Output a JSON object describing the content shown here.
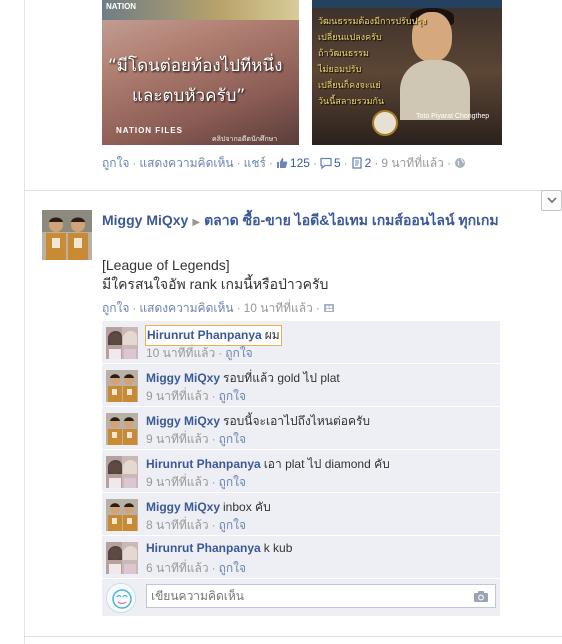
{
  "story": {
    "photo_a": {
      "top_label": "NATION",
      "quote_line1": "“มีโดนต่อยท้องไปทีหนึ่ง",
      "quote_line2": "และตบหัวครับ”",
      "logo": "NATION FILES",
      "logo_sub": "คลิปจากอดีตนักศึกษา"
    },
    "photo_b": {
      "lines": [
        "วัฒนธรรมต้องมีการปรับปรุง",
        "เปลี่ยนแปลงครับ",
        "ถ้าวัฒนธรรม",
        "ไม่ยอมปรับ",
        "เปลี่ยนก็คงจะแย่",
        "วันนี้สลายรวมกัน"
      ],
      "caption": "Toto Piyarat Chongthep"
    },
    "actions": {
      "like": "ถูกใจ",
      "comment": "แสดงความคิดเห็น",
      "share": "แชร์",
      "likes_count": "125",
      "comments_count": "5",
      "shares_count": "2",
      "time": "9 นาทีที่แล้ว"
    }
  },
  "post": {
    "author": "Miggy MiQxy",
    "group": "ตลาด ซื้อ-ขาย ไอดี&ไอเทม เกมส์ออนไลน์ ทุกเกม",
    "body_line1": "[League of Legends]",
    "body_line2": "มีใครสนใจอัพ rank เกมนี้หรือป่าวครับ",
    "actions": {
      "like": "ถูกใจ",
      "comment": "แสดงความคิดเห็น",
      "time": "10 นาทีที่แล้ว"
    }
  },
  "comments": [
    {
      "author": "Hirunrut Phanpanya",
      "text": "ผม",
      "time": "10 นาทีที่แล้ว",
      "like": "ถูกใจ",
      "avatar": "girl"
    },
    {
      "author": "Miggy MiQxy",
      "text": "รอบที่แล้ว gold ไป plat",
      "time": "9 นาทีที่แล้ว",
      "like": "ถูกใจ",
      "avatar": "boys"
    },
    {
      "author": "Miggy MiQxy",
      "text": "รอบนี้จะเอาไปถึงไหนต่อครับ",
      "time": "9 นาทีที่แล้ว",
      "like": "ถูกใจ",
      "avatar": "boys"
    },
    {
      "author": "Hirunrut Phanpanya",
      "text": "เอา plat ไป diamond คับ",
      "time": "9 นาทีที่แล้ว",
      "like": "ถูกใจ",
      "avatar": "girl"
    },
    {
      "author": "Miggy MiQxy",
      "text": "inbox คับ",
      "time": "8 นาทีที่แล้ว",
      "like": "ถูกใจ",
      "avatar": "boys"
    },
    {
      "author": "Hirunrut Phanpanya",
      "text": "k kub",
      "time": "6 นาทีที่แล้ว",
      "like": "ถูกใจ",
      "avatar": "girl"
    }
  ],
  "composer": {
    "placeholder": "เขียนความคิดเห็น"
  },
  "colors": {
    "link": "#3b5998",
    "muted_link": "#6d84b4",
    "comment_bg": "#edeff4",
    "meta": "#999999"
  }
}
